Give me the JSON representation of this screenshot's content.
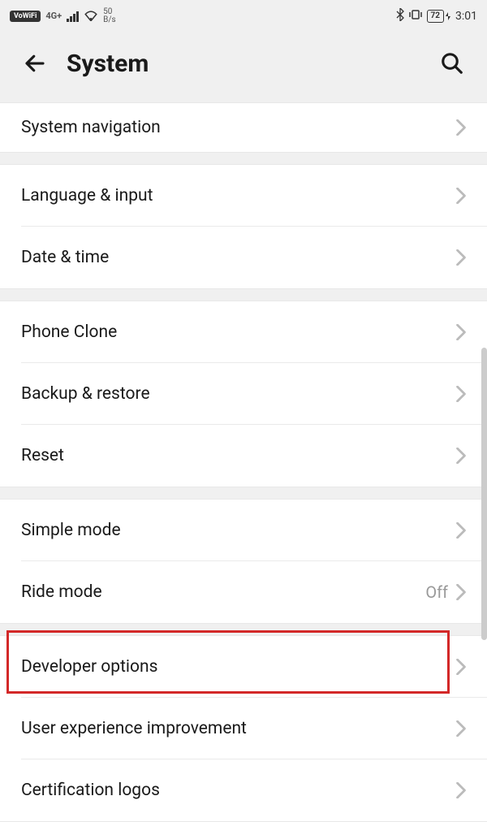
{
  "status": {
    "vowifi": "VoWiFi",
    "network_gen": "4G+",
    "speed_value": "50",
    "speed_unit": "B/s",
    "battery": "72",
    "time": "3:01"
  },
  "header": {
    "title": "System"
  },
  "sections": [
    {
      "items": [
        {
          "label": "System navigation",
          "key": "system-navigation"
        }
      ]
    },
    {
      "items": [
        {
          "label": "Language & input",
          "key": "language-input"
        },
        {
          "label": "Date & time",
          "key": "date-time"
        }
      ]
    },
    {
      "items": [
        {
          "label": "Phone Clone",
          "key": "phone-clone"
        },
        {
          "label": "Backup & restore",
          "key": "backup-restore"
        },
        {
          "label": "Reset",
          "key": "reset"
        }
      ]
    },
    {
      "items": [
        {
          "label": "Simple mode",
          "key": "simple-mode"
        },
        {
          "label": "Ride mode",
          "key": "ride-mode",
          "value": "Off"
        }
      ]
    },
    {
      "items": [
        {
          "label": "Developer options",
          "key": "developer-options"
        },
        {
          "label": "User experience improvement",
          "key": "user-experience"
        },
        {
          "label": "Certification logos",
          "key": "certification-logos"
        }
      ]
    }
  ]
}
